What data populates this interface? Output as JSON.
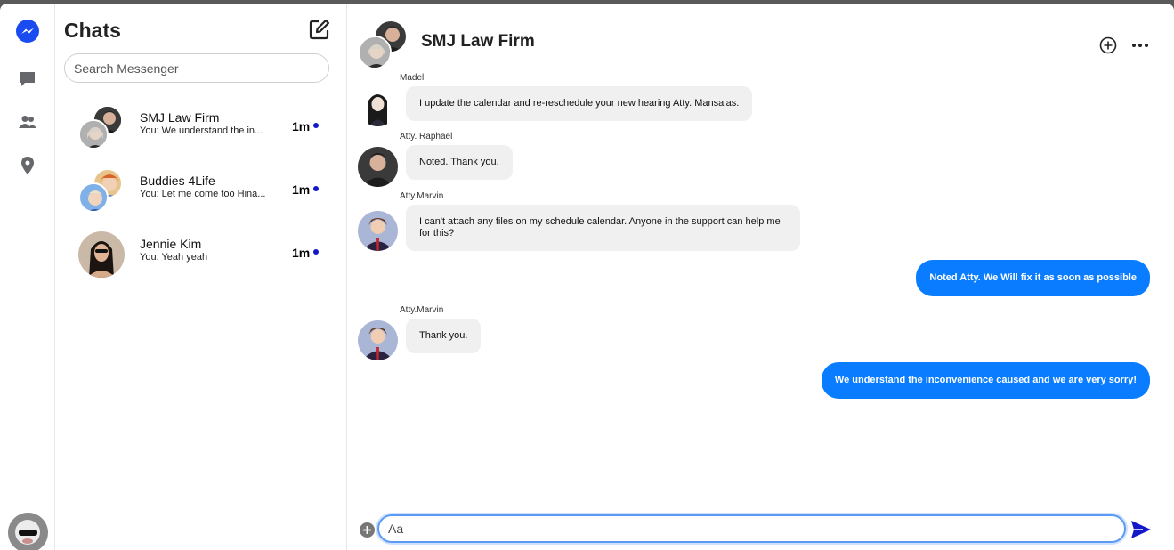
{
  "rail": {
    "icons": [
      "messenger-logo",
      "chat-bubble-icon",
      "people-icon",
      "location-pin-icon"
    ],
    "colors": {
      "brand": "#1a4bf0",
      "icon": "#65676b"
    }
  },
  "chats": {
    "title": "Chats",
    "search_placeholder": "Search Messenger",
    "items": [
      {
        "name": "SMJ Law Firm",
        "preview": "You: We understand the in...",
        "time": "1m"
      },
      {
        "name": "Buddies 4Life",
        "preview": "You: Let me come too Hina...",
        "time": "1m"
      },
      {
        "name": "Jennie Kim",
        "preview": "You: Yeah yeah",
        "time": "1m"
      }
    ]
  },
  "conversation": {
    "title": "SMJ Law Firm",
    "messages": [
      {
        "sender": "Madel",
        "text": "I update the calendar and re-reschedule your new hearing Atty. Mansalas."
      },
      {
        "sender": "Atty. Raphael",
        "text": "Noted. Thank you."
      },
      {
        "sender": "Atty.Marvin",
        "text": "I can't attach any files on my schedule calendar. Anyone in the support can help me for this?"
      },
      {
        "sender": "",
        "text": "Noted Atty. We Will fix it as soon as possible"
      },
      {
        "sender": "Atty.Marvin",
        "text": "Thank you."
      },
      {
        "sender": "",
        "text": "We understand the inconvenience caused and we are very sorry!"
      }
    ],
    "composer_placeholder": "Aa",
    "colors": {
      "outgoing": "#0a7cff",
      "incoming": "#f0f0f0"
    }
  }
}
